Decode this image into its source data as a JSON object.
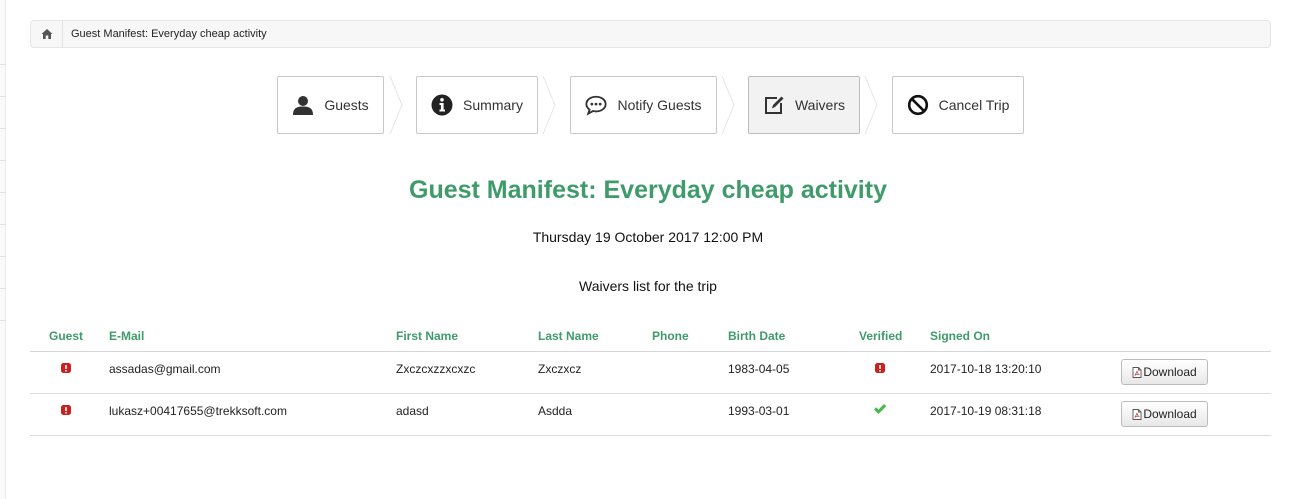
{
  "breadcrumb": {
    "home_icon": "home-icon",
    "current": "Guest Manifest: Everyday cheap activity"
  },
  "steps": [
    {
      "label": "Guests",
      "icon": "user-icon",
      "active": false
    },
    {
      "label": "Summary",
      "icon": "info-icon",
      "active": false
    },
    {
      "label": "Notify Guests",
      "icon": "chat-bubble-icon",
      "active": false
    },
    {
      "label": "Waivers",
      "icon": "edit-icon",
      "active": true
    },
    {
      "label": "Cancel Trip",
      "icon": "ban-icon",
      "active": false
    }
  ],
  "page": {
    "title": "Guest Manifest: Everyday cheap activity",
    "date": "Thursday 19 October 2017 12:00 PM",
    "list_title": "Waivers list for the trip"
  },
  "table": {
    "headers": {
      "guest": "Guest",
      "email": "E-Mail",
      "first_name": "First Name",
      "last_name": "Last Name",
      "phone": "Phone",
      "birth_date": "Birth Date",
      "verified": "Verified",
      "signed_on": "Signed On"
    },
    "download_label": "Download",
    "rows": [
      {
        "guest_status": "error",
        "email": "assadas@gmail.com",
        "first_name": "Zxczcxzzxcxzc",
        "last_name": "Zxczxcz",
        "phone": "",
        "birth_date": "1983-04-05",
        "verified": "error",
        "signed_on": "2017-10-18 13:20:10"
      },
      {
        "guest_status": "error",
        "email": "lukasz+00417655@trekksoft.com",
        "first_name": "adasd",
        "last_name": "Asdda",
        "phone": "",
        "birth_date": "1993-03-01",
        "verified": "ok",
        "signed_on": "2017-10-19 08:31:18"
      }
    ]
  },
  "colors": {
    "accent": "#3f9b6a",
    "error": "#cc1f1f",
    "ok": "#4bb84b"
  }
}
